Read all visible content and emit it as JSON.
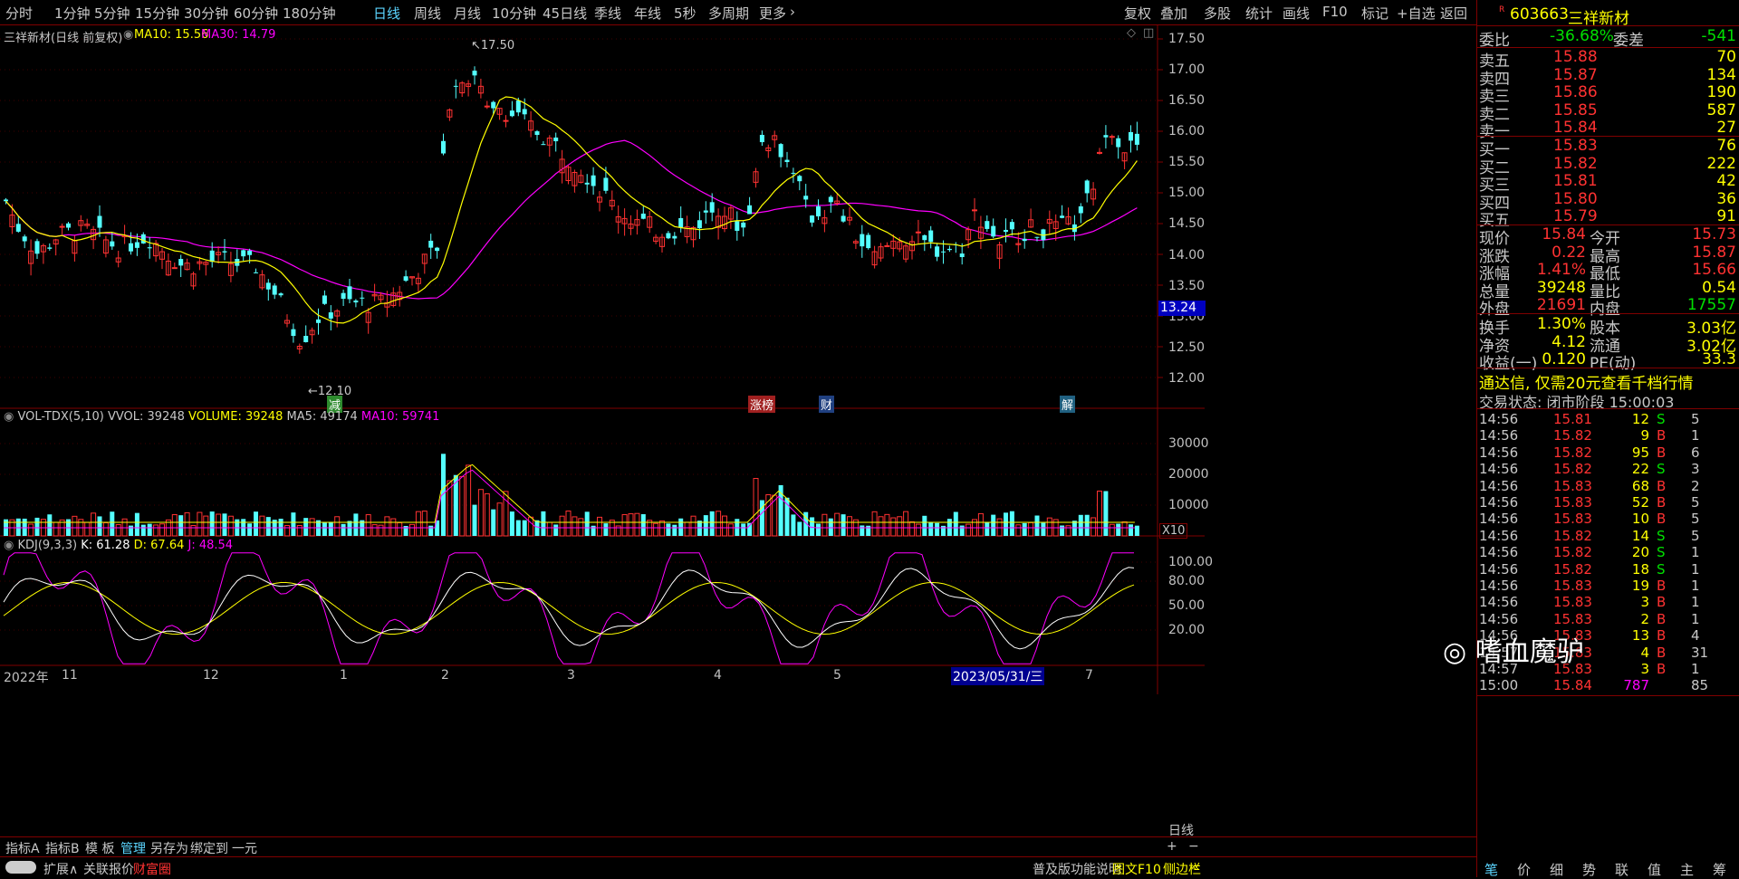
{
  "toolbar": {
    "left_items": [
      "分时",
      "1分钟",
      "5分钟",
      "15分钟",
      "30分钟",
      "60分钟",
      "180分钟",
      "日线",
      "周线",
      "月线",
      "10分钟",
      "45日线",
      "季线",
      "年线",
      "5秒",
      "多周期",
      "更多"
    ],
    "active_item": "日线",
    "right_items": [
      "复权",
      "叠加",
      "多股",
      "统计",
      "画线",
      "F10",
      "标记",
      "+自选",
      "返回"
    ]
  },
  "chart": {
    "title": "三祥新材(日线 前复权)",
    "ma10_label": "MA10: 15.56",
    "ma30_label": "MA30: 14.79",
    "high_label": "17.50",
    "low_label": "12.10",
    "current_price_box": "13.24",
    "price_axis": [
      "17.50",
      "17.00",
      "16.50",
      "16.00",
      "15.50",
      "15.00",
      "14.50",
      "14.00",
      "13.50",
      "13.00",
      "12.50",
      "12.00"
    ],
    "event_tags": [
      "减",
      "涨榜",
      "财",
      "解"
    ],
    "vol_title": "VOL-TDX(5,10)",
    "vol_labels": {
      "vvol": "VVOL: 39248",
      "volume": "VOLUME: 39248",
      "ma5": "MA5: 49174",
      "ma10": "MA10: 59741"
    },
    "vol_axis": [
      "30000",
      "20000",
      "10000"
    ],
    "vol_unit": "X10",
    "kdj_title": "KDJ(9,3,3)",
    "kdj_labels": {
      "k": "K: 61.28",
      "d": "D: 67.64",
      "j": "J: 48.54"
    },
    "kdj_axis": [
      "100.00",
      "80.00",
      "50.00",
      "20.00"
    ],
    "date_axis": [
      "2022年",
      "11",
      "12",
      "1",
      "2",
      "3",
      "4",
      "5",
      "2023/05/31/三",
      "7"
    ],
    "period_label": "日线"
  },
  "chart_data": {
    "type": "candlestick",
    "title": "三祥新材(日线 前复权)",
    "ylim": [
      12.0,
      17.5
    ],
    "high": 17.5,
    "low": 12.1,
    "last_close": 15.84,
    "ma10": 15.56,
    "ma30": 14.79,
    "volume": {
      "vvol": 39248,
      "ma5": 49174,
      "ma10": 59741
    },
    "kdj": {
      "k": 61.28,
      "d": 67.64,
      "j": 48.54
    }
  },
  "panel": {
    "code": "603663",
    "name": "三祥新材",
    "r_mark": "R",
    "weibi_label": "委比",
    "weibi_value": "-36.68%",
    "weicha_label": "委差",
    "weicha_value": "-541",
    "sells": [
      {
        "label": "卖五",
        "price": "15.88",
        "vol": "70"
      },
      {
        "label": "卖四",
        "price": "15.87",
        "vol": "134"
      },
      {
        "label": "卖三",
        "price": "15.86",
        "vol": "190"
      },
      {
        "label": "卖二",
        "price": "15.85",
        "vol": "587"
      },
      {
        "label": "卖一",
        "price": "15.84",
        "vol": "27"
      }
    ],
    "buys": [
      {
        "label": "买一",
        "price": "15.83",
        "vol": "76"
      },
      {
        "label": "买二",
        "price": "15.82",
        "vol": "222"
      },
      {
        "label": "买三",
        "price": "15.81",
        "vol": "42"
      },
      {
        "label": "买四",
        "price": "15.80",
        "vol": "36"
      },
      {
        "label": "买五",
        "price": "15.79",
        "vol": "91"
      }
    ],
    "stats": [
      {
        "l1": "现价",
        "v1": "15.84",
        "l2": "今开",
        "v2": "15.73"
      },
      {
        "l1": "涨跌",
        "v1": "0.22",
        "l2": "最高",
        "v2": "15.87"
      },
      {
        "l1": "涨幅",
        "v1": "1.41%",
        "l2": "最低",
        "v2": "15.66"
      },
      {
        "l1": "总量",
        "v1": "39248",
        "l2": "量比",
        "v2": "0.54"
      },
      {
        "l1": "外盘",
        "v1": "21691",
        "l2": "内盘",
        "v2": "17557"
      }
    ],
    "stats2": [
      {
        "l1": "换手",
        "v1": "1.30%",
        "l2": "股本",
        "v2": "3.03亿"
      },
      {
        "l1": "净资",
        "v1": "4.12",
        "l2": "流通",
        "v2": "3.02亿"
      },
      {
        "l1": "收益(一)",
        "v1": "0.120",
        "l2": "PE(动)",
        "v2": "33.3"
      }
    ],
    "promo": "通达信, 仅需20元查看千档行情",
    "status": "交易状态: 闭市阶段 15:00:03",
    "ticks": [
      {
        "t": "14:56",
        "p": "15.81",
        "v": "12",
        "s": "S",
        "n": "5"
      },
      {
        "t": "14:56",
        "p": "15.82",
        "v": "9",
        "s": "B",
        "n": "1"
      },
      {
        "t": "14:56",
        "p": "15.82",
        "v": "95",
        "s": "B",
        "n": "6"
      },
      {
        "t": "14:56",
        "p": "15.82",
        "v": "22",
        "s": "S",
        "n": "3"
      },
      {
        "t": "14:56",
        "p": "15.83",
        "v": "68",
        "s": "B",
        "n": "2"
      },
      {
        "t": "14:56",
        "p": "15.83",
        "v": "52",
        "s": "B",
        "n": "5"
      },
      {
        "t": "14:56",
        "p": "15.83",
        "v": "10",
        "s": "B",
        "n": "5"
      },
      {
        "t": "14:56",
        "p": "15.82",
        "v": "14",
        "s": "S",
        "n": "5"
      },
      {
        "t": "14:56",
        "p": "15.82",
        "v": "20",
        "s": "S",
        "n": "1"
      },
      {
        "t": "14:56",
        "p": "15.82",
        "v": "18",
        "s": "S",
        "n": "1"
      },
      {
        "t": "14:56",
        "p": "15.83",
        "v": "19",
        "s": "B",
        "n": "1"
      },
      {
        "t": "14:56",
        "p": "15.83",
        "v": "3",
        "s": "B",
        "n": "1"
      },
      {
        "t": "14:56",
        "p": "15.83",
        "v": "2",
        "s": "B",
        "n": "1"
      },
      {
        "t": "14:56",
        "p": "15.83",
        "v": "13",
        "s": "B",
        "n": "4"
      },
      {
        "t": "14:57",
        "p": "15.83",
        "v": "4",
        "s": "B",
        "n": "31"
      },
      {
        "t": "14:57",
        "p": "15.83",
        "v": "3",
        "s": "B",
        "n": "1"
      },
      {
        "t": "15:00",
        "p": "15.84",
        "v": "787",
        "s": "",
        "n": "85"
      }
    ],
    "watermark": "嗜血魔驴",
    "tabs": [
      "笔",
      "价",
      "细",
      "势",
      "联",
      "值",
      "主",
      "筹"
    ]
  },
  "bottom": {
    "row1": [
      "指标A",
      "指标B",
      "模 板",
      "管理",
      "另存为",
      "绑定到",
      "一元"
    ],
    "row1_right": [
      "日线",
      "+",
      "−"
    ],
    "row2": [
      "扩展∧",
      "关联报价",
      "财富圈"
    ],
    "row2_right": [
      "普及版功能说明",
      "图文F10",
      "侧边栏",
      "«"
    ]
  },
  "colors": {
    "up": "#ff3232",
    "down": "#54ffff",
    "ma_yellow": "#ffff00",
    "ma_magenta": "#ff00ff",
    "kdj_k": "#ffffff",
    "grid": "#800000"
  }
}
